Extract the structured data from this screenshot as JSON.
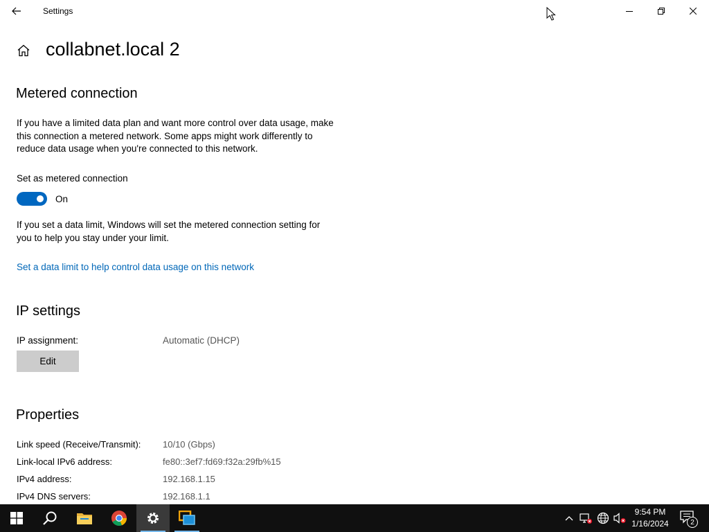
{
  "window": {
    "title": "Settings"
  },
  "page": {
    "title": "collabnet.local 2"
  },
  "metered": {
    "heading": "Metered connection",
    "description": "If you have a limited data plan and want more control over data usage, make this connection a metered network. Some apps might work differently to reduce data usage when you're connected to this network.",
    "toggle_label": "Set as metered connection",
    "toggle_state": "On",
    "toggle_on": true,
    "data_limit_note": "If you set a data limit, Windows will set the metered connection setting for you to help you stay under your limit.",
    "data_limit_link": "Set a data limit to help control data usage on this network"
  },
  "ip_settings": {
    "heading": "IP settings",
    "assignment_label": "IP assignment:",
    "assignment_value": "Automatic (DHCP)",
    "edit_label": "Edit"
  },
  "properties": {
    "heading": "Properties",
    "rows": [
      {
        "label": "Link speed (Receive/Transmit):",
        "value": "10/10 (Gbps)"
      },
      {
        "label": "Link-local IPv6 address:",
        "value": "fe80::3ef7:fd69:f32a:29fb%15"
      },
      {
        "label": "IPv4 address:",
        "value": "192.168.1.15"
      },
      {
        "label": "IPv4 DNS servers:",
        "value": "192.168.1.1"
      }
    ]
  },
  "taskbar": {
    "apps": [
      "start-icon",
      "search-icon",
      "file-explorer-icon",
      "chrome-icon",
      "settings-icon",
      "vmware-icon"
    ],
    "active_app": "settings-icon",
    "tray_icons": [
      "chevron-up-icon",
      "network-warning-icon",
      "globe-icon",
      "volume-muted-icon"
    ],
    "time": "9:54 PM",
    "date": "1/16/2024",
    "notification_count": "2"
  },
  "colors": {
    "accent": "#0067c0",
    "link": "#0067b8",
    "taskbar": "#101010",
    "button": "#cccccc"
  }
}
